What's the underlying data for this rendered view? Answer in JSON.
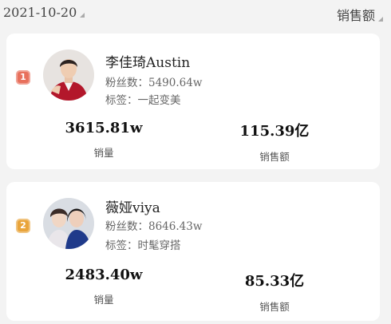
{
  "header": {
    "date": "2021-10-20",
    "sort_label": "销售额"
  },
  "ranking": [
    {
      "rank": "1",
      "rank_color": "#e8705c",
      "name": "李佳琦Austin",
      "fans_label": "粉丝数：",
      "fans_value": "5490.64w",
      "tags_label": "标签：",
      "tags_value": "一起变美",
      "volume": "3615.81w",
      "volume_label": "销量",
      "amount": "115.39亿",
      "amount_label": "销售额"
    },
    {
      "rank": "2",
      "rank_color": "#e9a43a",
      "name": "薇娅viya",
      "fans_label": "粉丝数：",
      "fans_value": "8646.43w",
      "tags_label": "标签：",
      "tags_value": "时髦穿搭",
      "volume": "2483.40w",
      "volume_label": "销量",
      "amount": "85.33亿",
      "amount_label": "销售额"
    }
  ]
}
